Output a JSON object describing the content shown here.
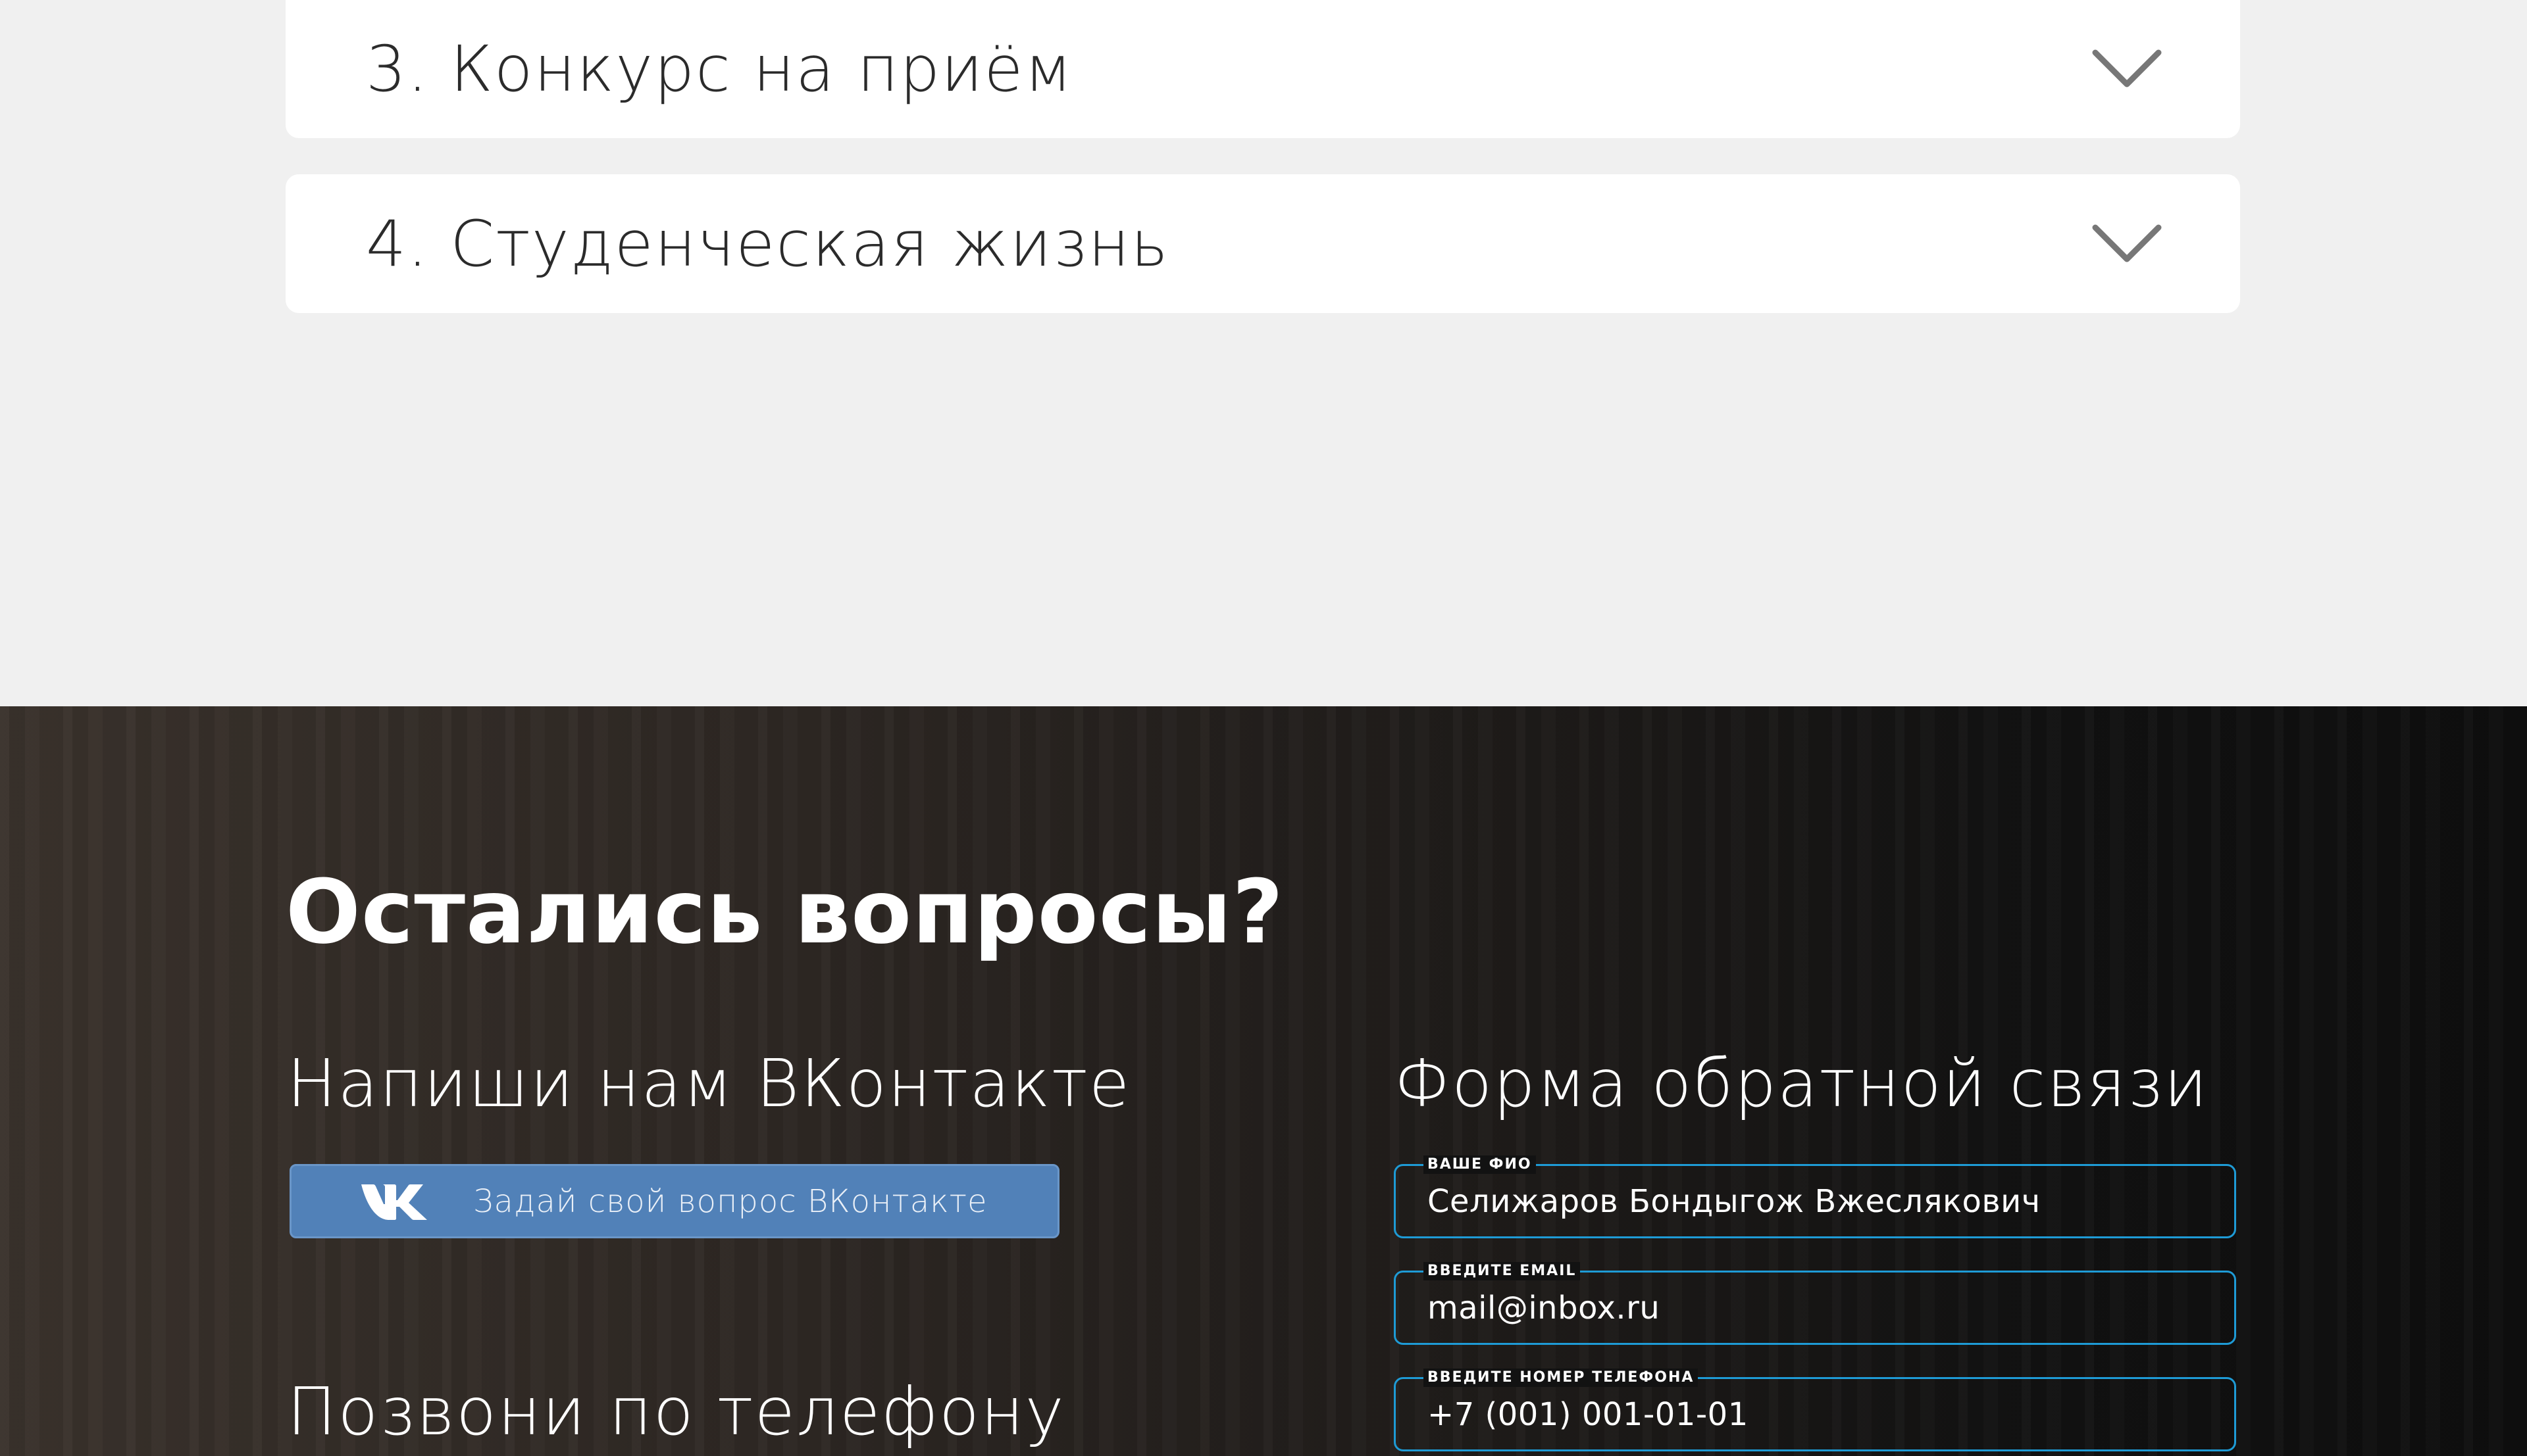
{
  "faq": {
    "items": [
      {
        "label": "3. Конкурс на приём",
        "expanded": false
      },
      {
        "label": "4. Студенческая жизнь",
        "expanded": false
      }
    ]
  },
  "contact": {
    "title": "Остались вопросы?",
    "vk": {
      "heading": "Напиши нам ВКонтакте",
      "button_label": "Задай свой вопрос ВКонтакте",
      "button_icon": "vk-logo-icon"
    },
    "phone": {
      "heading": "Позвони по телефону"
    },
    "form": {
      "heading": "Форма обратной связи",
      "fields": [
        {
          "label": "Ваше ФИО",
          "value": "Селижаров Бондыгож Вжеслякович"
        },
        {
          "label": "Введите email",
          "value": "mail@inbox.ru"
        },
        {
          "label": "Введите номер телефона",
          "value": "+7 (001) 001-01-01"
        }
      ]
    }
  },
  "colors": {
    "accent_border": "#1e9bd6",
    "vk_blue": "#5181b8",
    "faq_background": "#f0f0f0",
    "card_background": "#ffffff"
  }
}
